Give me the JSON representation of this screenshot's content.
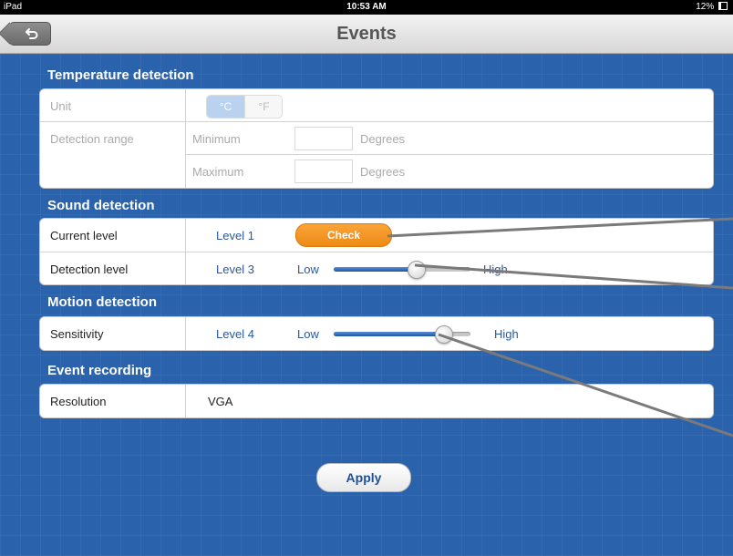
{
  "status_bar": {
    "device": "iPad",
    "time": "10:53 AM",
    "battery": "12%"
  },
  "nav": {
    "title": "Events"
  },
  "temperature": {
    "section_title": "Temperature detection",
    "unit_label": "Unit",
    "unit_celsius": "°C",
    "unit_fahrenheit": "°F",
    "selected_unit": "°C",
    "range_label": "Detection range",
    "min_label": "Minimum",
    "max_label": "Maximum",
    "min_value": "",
    "max_value": "",
    "degrees": "Degrees"
  },
  "sound": {
    "section_title": "Sound detection",
    "current_label": "Current level",
    "current_value": "Level 1",
    "check_label": "Check",
    "detection_label": "Detection level",
    "detection_value": "Level 3",
    "low": "Low",
    "high": "High",
    "slider_level": 0.6
  },
  "motion": {
    "section_title": "Motion detection",
    "sensitivity_label": "Sensitivity",
    "sensitivity_value": "Level 4",
    "low": "Low",
    "high": "High",
    "slider_level": 0.8
  },
  "recording": {
    "section_title": "Event recording",
    "resolution_label": "Resolution",
    "resolution_value": "VGA"
  },
  "actions": {
    "apply_label": "Apply"
  }
}
